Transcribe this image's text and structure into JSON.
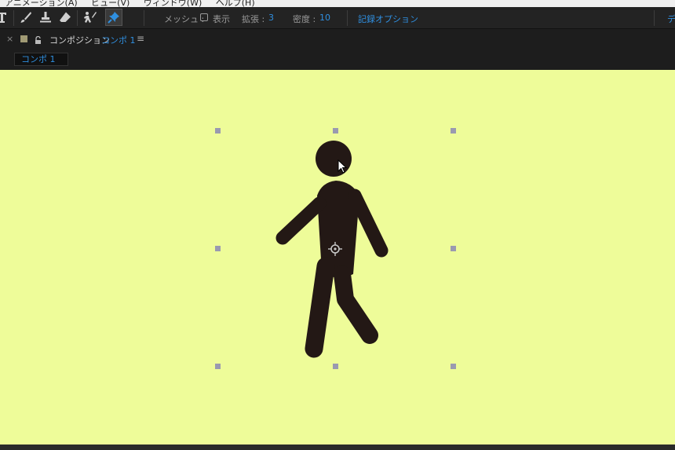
{
  "menubar": {
    "items": [
      "アニメーション(A)",
      "ビュー(V)",
      "ウィンドウ(W)",
      "ヘルプ(H)"
    ]
  },
  "toolbar": {
    "mesh_label": "メッシュ :",
    "show_label": "表示",
    "expand_label": "拡張 :",
    "expand_value": "3",
    "density_label": "密度 :",
    "density_value": "10",
    "record_options": "記録オプション",
    "right_cut_label": "デ"
  },
  "panel": {
    "close": "×",
    "title_prefix": "コンポジション",
    "comp_name": "コンポ 1",
    "menu_icon": "≡"
  },
  "tab": {
    "label": "コンポ 1"
  },
  "colors": {
    "canvas_bg": "#eefc99",
    "figure": "#231815",
    "accent": "#2f8fe0"
  },
  "icons": {
    "tools": [
      "type-tool-icon",
      "brush-tool-icon",
      "clone-stamp-tool-icon",
      "eraser-tool-icon",
      "roto-brush-tool-icon",
      "puppet-pin-tool-icon"
    ],
    "cursor": "mouse-pointer-icon",
    "anchor": "anchor-point-icon"
  }
}
